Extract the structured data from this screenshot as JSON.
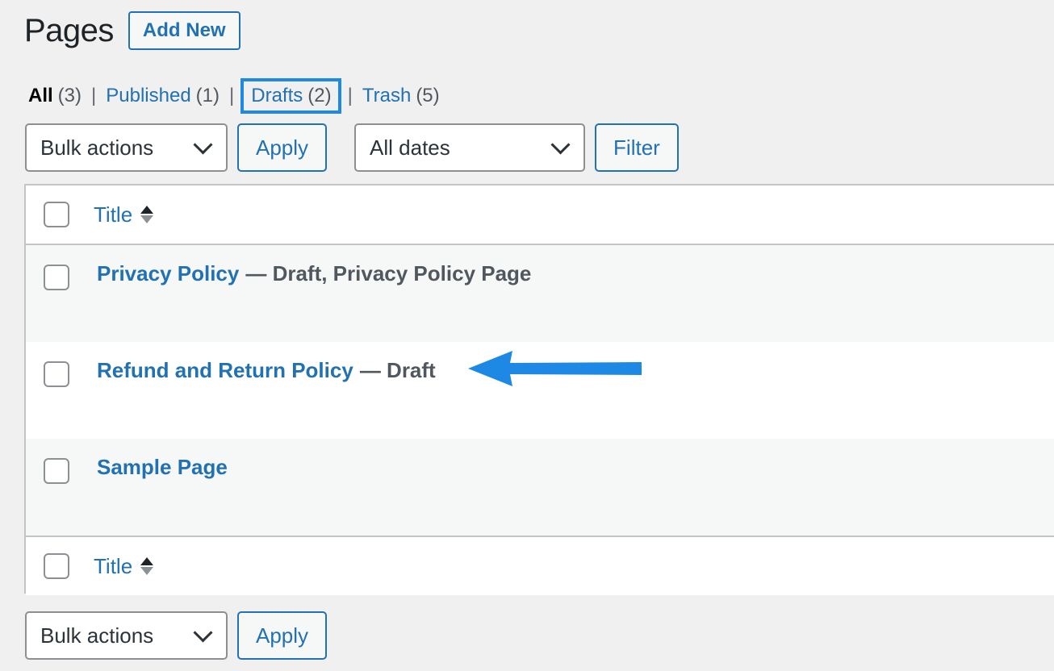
{
  "header": {
    "title": "Pages",
    "add_new_label": "Add New"
  },
  "views": {
    "all": {
      "label": "All",
      "count": "(3)"
    },
    "published": {
      "label": "Published",
      "count": "(1)"
    },
    "drafts": {
      "label": "Drafts",
      "count": "(2)"
    },
    "trash": {
      "label": "Trash",
      "count": "(5)"
    },
    "separator": "|"
  },
  "tablenav_top": {
    "bulk_actions": "Bulk actions",
    "apply_label": "Apply",
    "dates": "All dates",
    "filter_label": "Filter"
  },
  "table": {
    "column_title": "Title",
    "rows": [
      {
        "title": "Privacy Policy",
        "state": "— Draft, Privacy Policy Page"
      },
      {
        "title": "Refund and Return Policy",
        "state": "— Draft"
      },
      {
        "title": "Sample Page",
        "state": ""
      }
    ]
  },
  "tablenav_bottom": {
    "bulk_actions": "Bulk actions",
    "apply_label": "Apply"
  },
  "colors": {
    "link": "#2271b1",
    "highlight": "#1e88e5",
    "background": "#f0f0f1"
  }
}
